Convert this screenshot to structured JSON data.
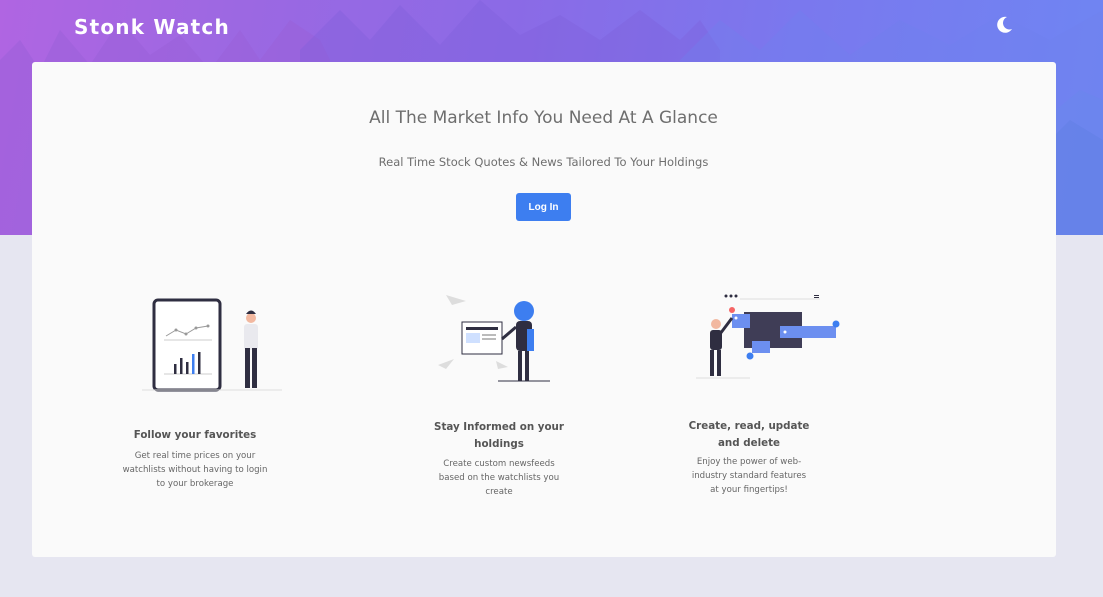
{
  "app": {
    "brand": "Stonk Watch"
  },
  "hero": {
    "headline": "All The Market Info You Need At A Glance",
    "subheadline": "Real Time Stock Quotes & News Tailored To Your Holdings",
    "login_label": "Log In"
  },
  "features": [
    {
      "title": "Follow your favorites",
      "description": "Get real time prices on your watchlists without having to login to your brokerage"
    },
    {
      "title": "Stay Informed on your holdings",
      "description": "Create custom newsfeeds based on the watchlists you create"
    },
    {
      "title": "Create, read, update and delete",
      "description": "Enjoy the power of web-industry standard features at your fingertips!"
    }
  ],
  "colors": {
    "accent": "#3d7ef0",
    "hero_start": "#b065e2",
    "hero_end": "#6e86f3",
    "page_bg": "#e6e6f1",
    "card_bg": "#fafafa",
    "illustration_dark": "#2f2e41"
  },
  "icons": {
    "theme_toggle": "moon-icon"
  }
}
